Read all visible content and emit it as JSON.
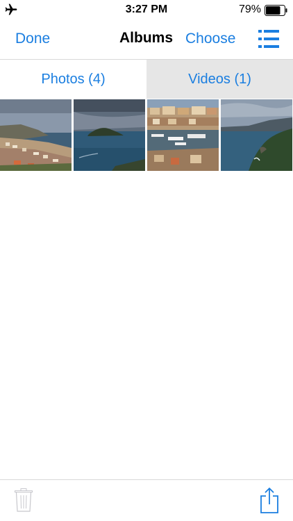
{
  "status_bar": {
    "airplane_icon": "airplane-icon",
    "time": "3:27 PM",
    "battery_percent": "79%",
    "battery_level": 0.79
  },
  "nav": {
    "done_label": "Done",
    "title": "Albums",
    "choose_label": "Choose",
    "list_icon": "list-icon"
  },
  "tabs": [
    {
      "label": "Photos (4)",
      "selected": true
    },
    {
      "label": "Videos (1)",
      "selected": false
    }
  ],
  "thumbnails": [
    {
      "icon": "photo-thumbnail",
      "scene": "coastal town with harbor"
    },
    {
      "icon": "photo-thumbnail",
      "scene": "island in the sea"
    },
    {
      "icon": "photo-thumbnail",
      "scene": "harbor town with boats"
    },
    {
      "icon": "photo-thumbnail",
      "scene": "rocky coastline"
    }
  ],
  "toolbar": {
    "trash_icon": "trash-icon",
    "share_icon": "share-icon"
  },
  "colors": {
    "accent": "#1a7ee0",
    "tab_selected_bg": "#ffffff",
    "tab_unselected_bg": "#e6e6e6",
    "disabled": "#c7c7cc"
  }
}
